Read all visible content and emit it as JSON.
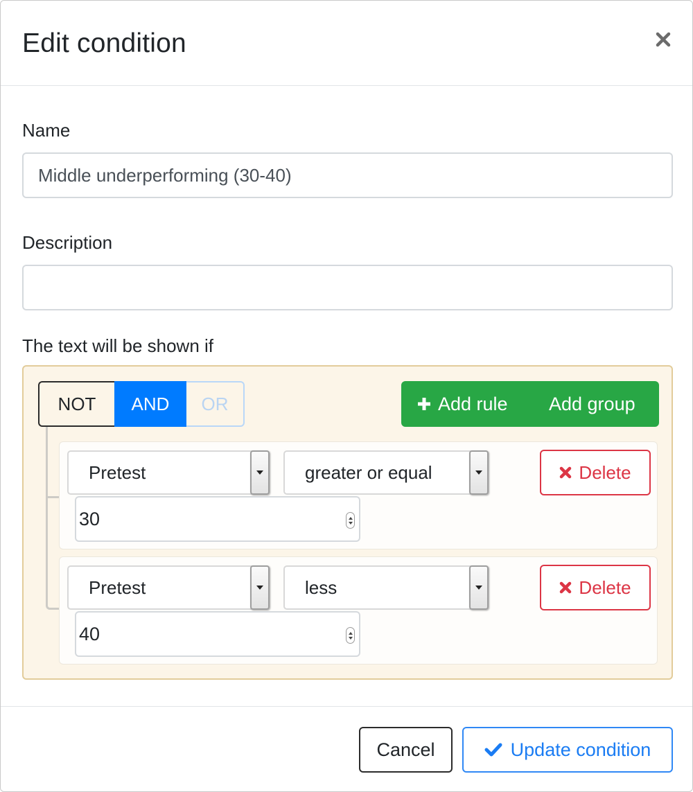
{
  "modal": {
    "title": "Edit condition",
    "close_icon": "close-icon"
  },
  "form": {
    "name_label": "Name",
    "name_value": "Middle underperforming (30-40)",
    "description_label": "Description",
    "description_value": "",
    "condition_label": "The text will be shown if"
  },
  "builder": {
    "logic": {
      "not_label": "NOT",
      "and_label": "AND",
      "or_label": "OR",
      "selected": "AND"
    },
    "actions": {
      "add_rule_label": "Add rule",
      "add_rule_icon": "plus-icon",
      "add_group_label": "Add group"
    },
    "rules": [
      {
        "field": "Pretest",
        "operator": "greater or equal",
        "value": "30",
        "delete_label": "Delete"
      },
      {
        "field": "Pretest",
        "operator": "less",
        "value": "40",
        "delete_label": "Delete"
      }
    ]
  },
  "footer": {
    "cancel_label": "Cancel",
    "update_label": "Update condition",
    "update_icon": "check-icon"
  },
  "colors": {
    "primary": "#007bff",
    "success": "#28a745",
    "danger": "#dc3545",
    "builder_bg": "#fcf5e8",
    "builder_border": "#e2cc9a"
  }
}
